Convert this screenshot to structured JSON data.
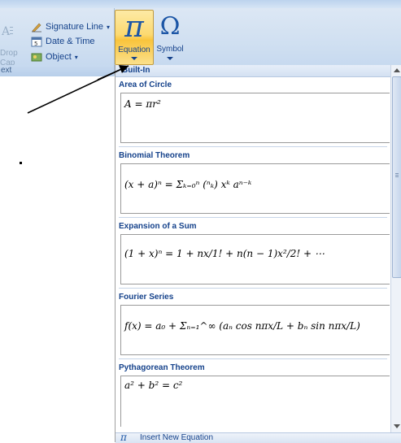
{
  "ribbon": {
    "text_group": {
      "drop_cap_label": "Drop Cap",
      "signature_line_label": "Signature Line",
      "date_time_label": "Date & Time",
      "object_label": "Object",
      "caption": "ext"
    },
    "equation_button": {
      "glyph": "π",
      "label": "Equation"
    },
    "symbol_button": {
      "glyph": "Ω",
      "label": "Symbol"
    }
  },
  "gallery": {
    "header": "Built-In",
    "sections": [
      {
        "title": "Area of Circle",
        "equation": "A = πr²"
      },
      {
        "title": "Binomial Theorem",
        "equation": "(x + a)ⁿ = Σₖ₌₀ⁿ (ⁿₖ) xᵏ aⁿ⁻ᵏ"
      },
      {
        "title": "Expansion of a Sum",
        "equation": "(1 + x)ⁿ = 1 + nx/1! + n(n − 1)x²/2! + ⋯"
      },
      {
        "title": "Fourier Series",
        "equation": "f(x) = a₀ + Σₙ₌₁^∞ (aₙ cos nπx/L + bₙ sin nπx/L)"
      },
      {
        "title": "Pythagorean Theorem",
        "equation": "a² + b² = c²"
      }
    ],
    "insert_icon": "π",
    "insert_label": "Insert New Equation"
  },
  "colors": {
    "accent": "#15428b",
    "highlight": "#fcd970",
    "ribbon": "#cfdff1"
  }
}
